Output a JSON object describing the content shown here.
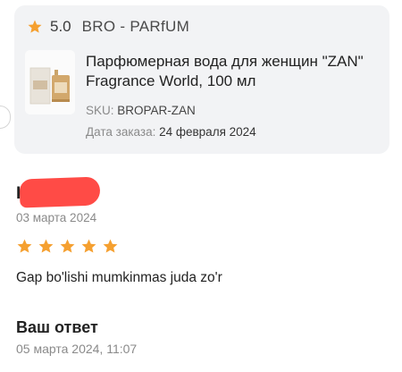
{
  "product_card": {
    "rating": "5.0",
    "brand": "BRO - PARfUM",
    "title": "Парфюмерная вода для женщин \"ZAN\" Fragrance World, 100 мл",
    "sku_label": "SKU:",
    "sku_value": "BROPAR-ZAN",
    "order_date_label": "Дата заказа:",
    "order_date_value": "24 февраля 2024",
    "colors": {
      "background": "#f2f3f5",
      "star": "#f5a030"
    }
  },
  "review": {
    "reviewer_initial": "I",
    "date": "03 марта 2024",
    "stars": 5,
    "text": "Gap bo'lishi mumkinmas juda zo'r",
    "colors": {
      "star": "#f5a030",
      "redaction": "#ff4b46"
    }
  },
  "answer": {
    "title": "Ваш ответ",
    "date": "05 марта 2024, 11:07"
  },
  "icons": {
    "rating_star": "star-icon",
    "review_star": "star-icon"
  }
}
